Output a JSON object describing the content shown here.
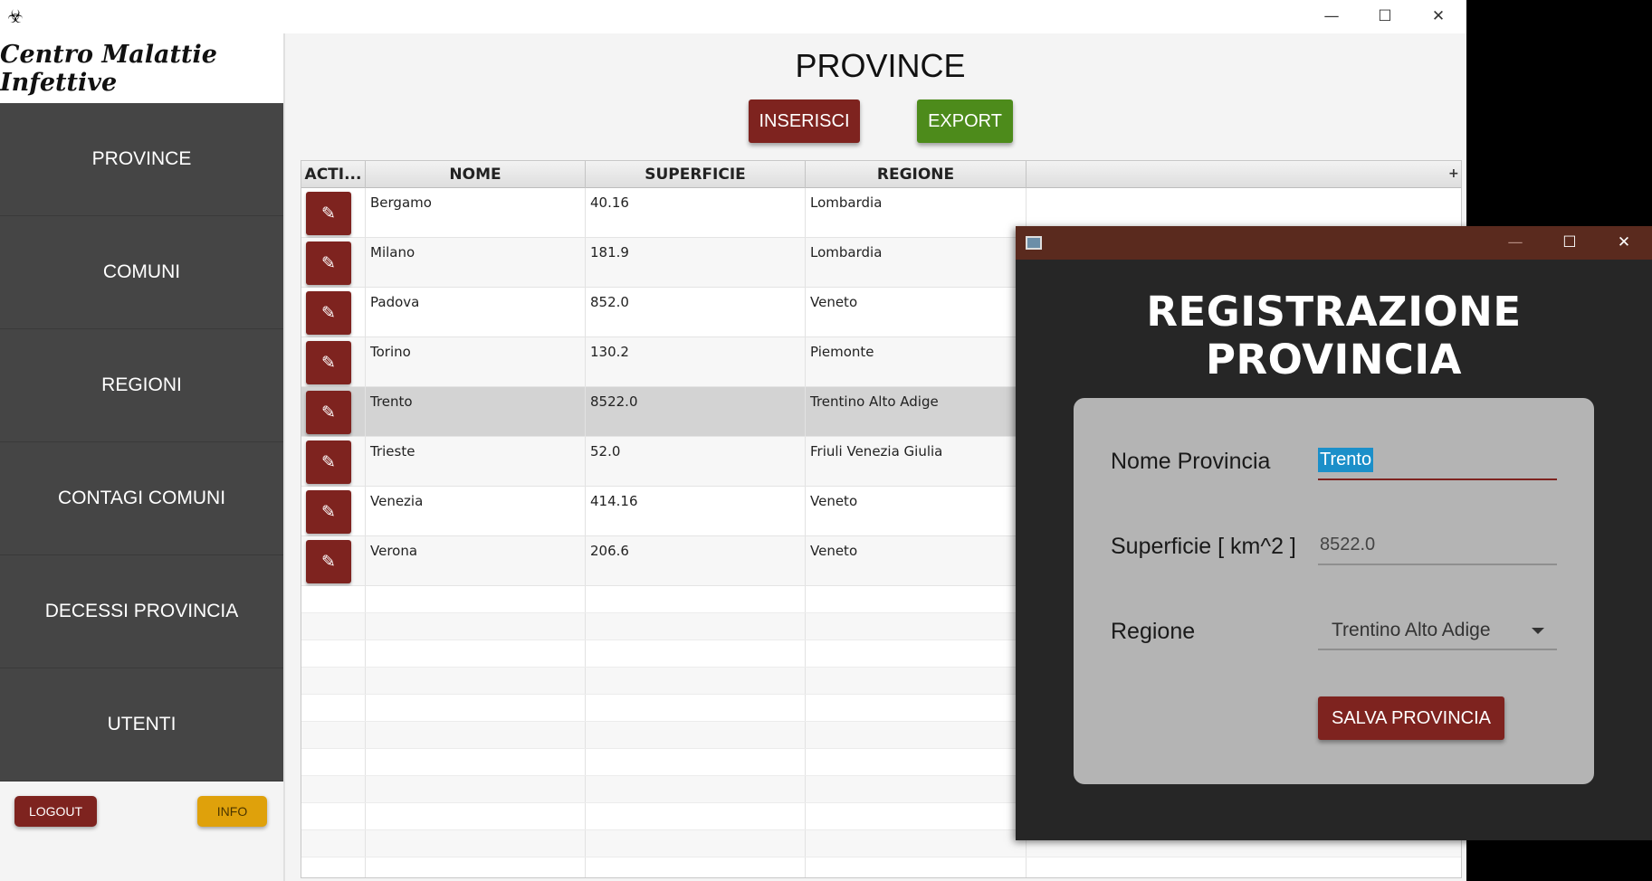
{
  "app": {
    "icon": "biohazard-icon",
    "brand": "Centro Malattie Infettive"
  },
  "window_controls": {
    "minimize": "—",
    "maximize": "☐",
    "close": "✕"
  },
  "sidebar": {
    "items": [
      {
        "label": "PROVINCE"
      },
      {
        "label": "COMUNI"
      },
      {
        "label": "REGIONI"
      },
      {
        "label": "CONTAGI COMUNI"
      },
      {
        "label": "DECESSI PROVINCIA"
      },
      {
        "label": "UTENTI"
      }
    ],
    "logout_label": "LOGOUT",
    "info_label": "INFO"
  },
  "main": {
    "title": "PROVINCE",
    "insert_label": "INSERISCI",
    "export_label": "EXPORT"
  },
  "table": {
    "columns": [
      "ACTI...",
      "NOME",
      "SUPERFICIE",
      "REGIONE"
    ],
    "plus": "+",
    "edit_glyph": "✎",
    "selected_row": 4,
    "rows": [
      {
        "nome": "Bergamo",
        "superficie": "40.16",
        "regione": "Lombardia"
      },
      {
        "nome": "Milano",
        "superficie": "181.9",
        "regione": "Lombardia"
      },
      {
        "nome": "Padova",
        "superficie": "852.0",
        "regione": "Veneto"
      },
      {
        "nome": "Torino",
        "superficie": "130.2",
        "regione": "Piemonte"
      },
      {
        "nome": "Trento",
        "superficie": "8522.0",
        "regione": "Trentino Alto Adige"
      },
      {
        "nome": "Trieste",
        "superficie": "52.0",
        "regione": "Friuli Venezia Giulia"
      },
      {
        "nome": "Venezia",
        "superficie": "414.16",
        "regione": "Veneto"
      },
      {
        "nome": "Verona",
        "superficie": "206.6",
        "regione": "Veneto"
      }
    ],
    "empty_rows": 11
  },
  "dialog": {
    "title": "REGISTRAZIONE PROVINCIA",
    "nome_label": "Nome Provincia",
    "nome_value": "Trento",
    "superficie_label": "Superficie [ km^2  ]",
    "superficie_value": "8522.0",
    "regione_label": "Regione",
    "regione_value": "Trentino Alto Adige",
    "save_label": "SALVA PROVINCIA"
  },
  "colors": {
    "primary_red": "#7e231f",
    "export_green": "#4d8b1b",
    "info_yellow": "#dfa10b",
    "sidebar_bg": "#454545",
    "dialog_bg": "#262626",
    "dialog_titlebar": "#5a2a1e",
    "selection_blue": "#1b8fc9"
  }
}
